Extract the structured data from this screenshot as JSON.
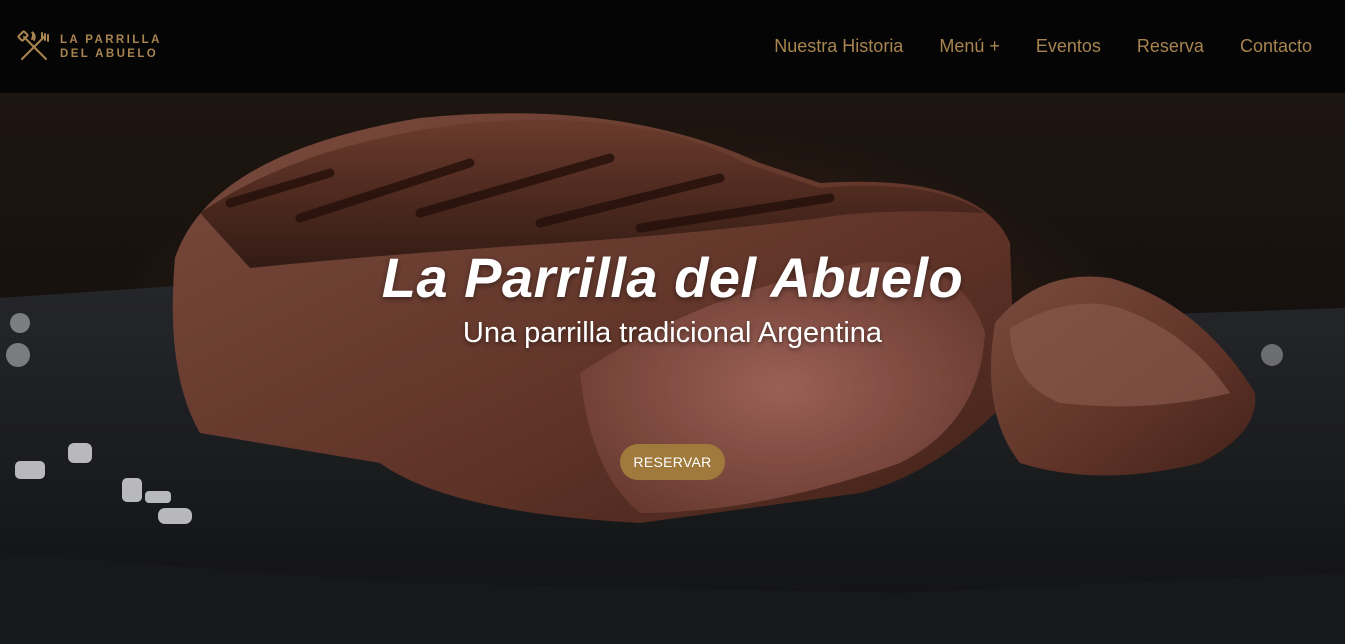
{
  "brand": {
    "line1": "LA PARRILLA",
    "line2": "DEL ABUELO",
    "icon": "grill-utensils-icon",
    "color": "#a88450"
  },
  "nav": {
    "items": [
      {
        "label": "Nuestra Historia"
      },
      {
        "label": "Menú +"
      },
      {
        "label": "Eventos"
      },
      {
        "label": "Reserva"
      },
      {
        "label": "Contacto"
      }
    ]
  },
  "hero": {
    "title": "La Parrilla del Abuelo",
    "subtitle": "Una parrilla tradicional Argentina",
    "button_label": "RESERVAR",
    "button_color": "#a07a3c",
    "image": "grilled-steak-on-slate-photo"
  }
}
